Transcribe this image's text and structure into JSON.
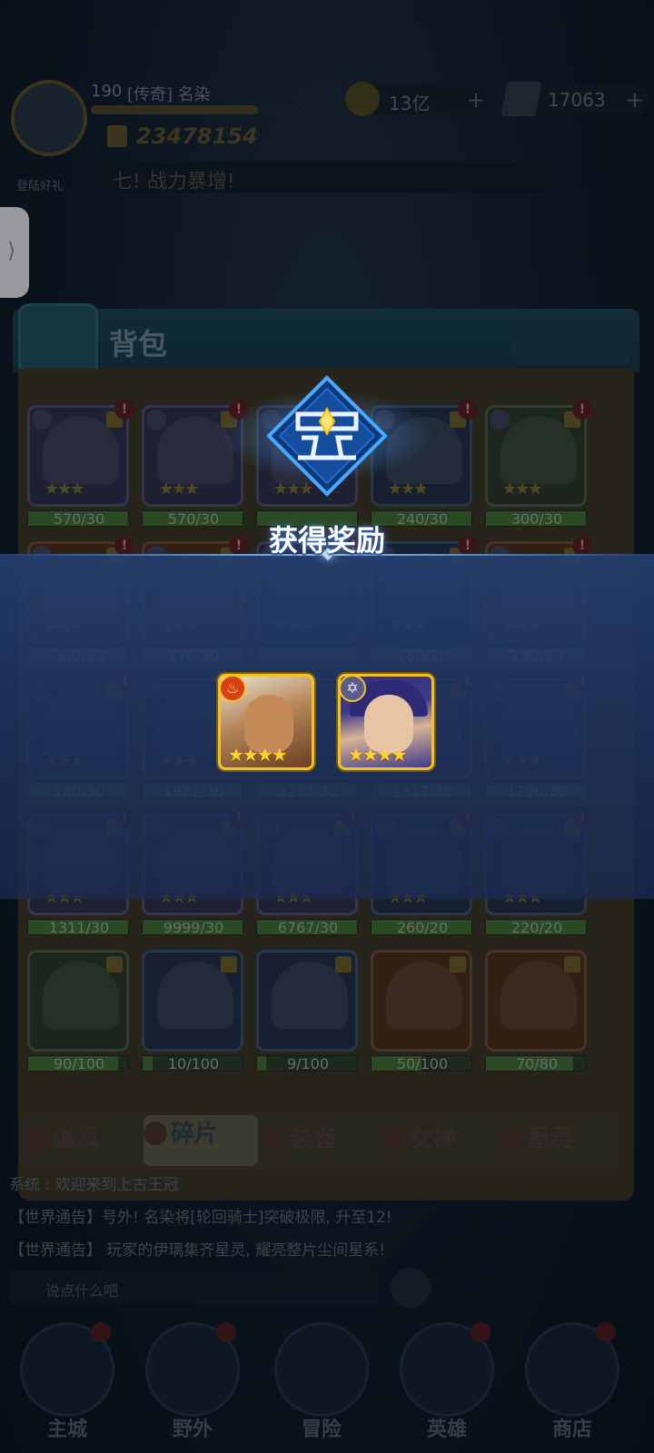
{
  "hud": {
    "level": "190",
    "player_name": "[传奇] 名染",
    "power": "23478154",
    "gold": "13亿",
    "gems": "17063",
    "banner_text": "七! 战力暴增!",
    "sub_caption": "登陆好礼"
  },
  "bag": {
    "title": "背包",
    "rows": [
      [
        {
          "progress": "570/30",
          "fill": 1.0
        },
        {
          "progress": "570/30",
          "fill": 1.0
        },
        {
          "progress": "",
          "fill": 1.0
        },
        {
          "progress": "240/30",
          "fill": 1.0
        },
        {
          "progress": "300/30",
          "fill": 1.0
        }
      ],
      [
        {
          "progress": "300/30",
          "fill": 1.0
        },
        {
          "progress": "270/30",
          "fill": 1.0
        },
        {
          "progress": "",
          "fill": 1.0
        },
        {
          "progress": "180/30",
          "fill": 1.0
        },
        {
          "progress": "240/30",
          "fill": 1.0
        }
      ],
      [
        {
          "progress": "180/30",
          "fill": 1.0
        },
        {
          "progress": "1971/30",
          "fill": 1.0
        },
        {
          "progress": "2208/30",
          "fill": 1.0
        },
        {
          "progress": "1317/30",
          "fill": 1.0
        },
        {
          "progress": "1290/30",
          "fill": 1.0
        }
      ],
      [
        {
          "progress": "1311/30",
          "fill": 1.0
        },
        {
          "progress": "9999/30",
          "fill": 1.0
        },
        {
          "progress": "6767/30",
          "fill": 1.0
        },
        {
          "progress": "260/20",
          "fill": 1.0
        },
        {
          "progress": "220/20",
          "fill": 1.0
        }
      ],
      [
        {
          "progress": "90/100",
          "fill": 0.9
        },
        {
          "progress": "10/100",
          "fill": 0.1
        },
        {
          "progress": "9/100",
          "fill": 0.09
        },
        {
          "progress": "50/100",
          "fill": 0.5
        },
        {
          "progress": "70/80",
          "fill": 0.875
        }
      ]
    ],
    "tabs": [
      "道具",
      "碎片",
      "装备",
      "女神",
      "星灵"
    ],
    "active_tab": 1
  },
  "chat": {
    "lines": [
      "系统  :  欢迎来到上古王冠",
      "【世界通告】号外! 名染将[轮回骑士]突破极限, 升至12!",
      "【世界通告】 玩家的伊璃集齐星灵, 耀亮整片尘间星系!"
    ],
    "placeholder": "说点什么吧"
  },
  "nav": [
    "主城",
    "野外",
    "冒险",
    "英雄",
    "商店"
  ],
  "reward": {
    "title": "获得奖励",
    "heroes": [
      {
        "faction_icon": "fire-faction-icon",
        "stars": 4
      },
      {
        "faction_icon": "star-faction-icon",
        "stars": 4
      }
    ]
  },
  "colors": {
    "band": "#243e6e",
    "card_border": "#f2c22a",
    "star": "#ffd42a"
  }
}
